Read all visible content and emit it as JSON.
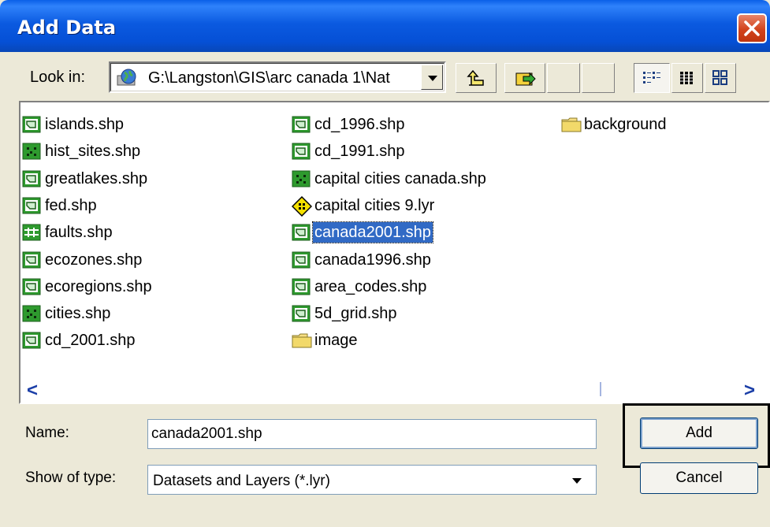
{
  "window": {
    "title": "Add Data"
  },
  "lookin": {
    "label": "Look in:",
    "path": "G:\\Langston\\GIS\\arc canada 1\\Nat"
  },
  "files": [
    {
      "name": "islands.shp",
      "icon": "polygon-shapefile-icon"
    },
    {
      "name": "hist_sites.shp",
      "icon": "point-shapefile-icon"
    },
    {
      "name": "greatlakes.shp",
      "icon": "polygon-shapefile-icon"
    },
    {
      "name": "fed.shp",
      "icon": "polygon-shapefile-icon"
    },
    {
      "name": "faults.shp",
      "icon": "line-shapefile-icon"
    },
    {
      "name": "ecozones.shp",
      "icon": "polygon-shapefile-icon"
    },
    {
      "name": "ecoregions.shp",
      "icon": "polygon-shapefile-icon"
    },
    {
      "name": "cities.shp",
      "icon": "point-shapefile-icon"
    },
    {
      "name": "cd_2001.shp",
      "icon": "polygon-shapefile-icon"
    },
    {
      "name": "cd_1996.shp",
      "icon": "polygon-shapefile-icon"
    },
    {
      "name": "cd_1991.shp",
      "icon": "polygon-shapefile-icon"
    },
    {
      "name": "capital cities canada.shp",
      "icon": "point-shapefile-icon"
    },
    {
      "name": "capital cities 9.lyr",
      "icon": "layer-file-icon"
    },
    {
      "name": "canada2001.shp",
      "icon": "polygon-shapefile-icon",
      "selected": true
    },
    {
      "name": "canada1996.shp",
      "icon": "polygon-shapefile-icon"
    },
    {
      "name": "area_codes.shp",
      "icon": "polygon-shapefile-icon"
    },
    {
      "name": "5d_grid.shp",
      "icon": "polygon-shapefile-icon"
    },
    {
      "name": "image",
      "icon": "folder-icon"
    },
    {
      "name": "background",
      "icon": "folder-icon"
    }
  ],
  "bottom": {
    "name_label": "Name:",
    "name_value": "canada2001.shp",
    "type_label": "Show of type:",
    "type_value": "Datasets and Layers (*.lyr)",
    "add_label": "Add",
    "cancel_label": "Cancel"
  },
  "colors": {
    "titlebar": "#0550d6",
    "selection": "#316ac5",
    "shapefile_green": "#2e9a2e"
  }
}
